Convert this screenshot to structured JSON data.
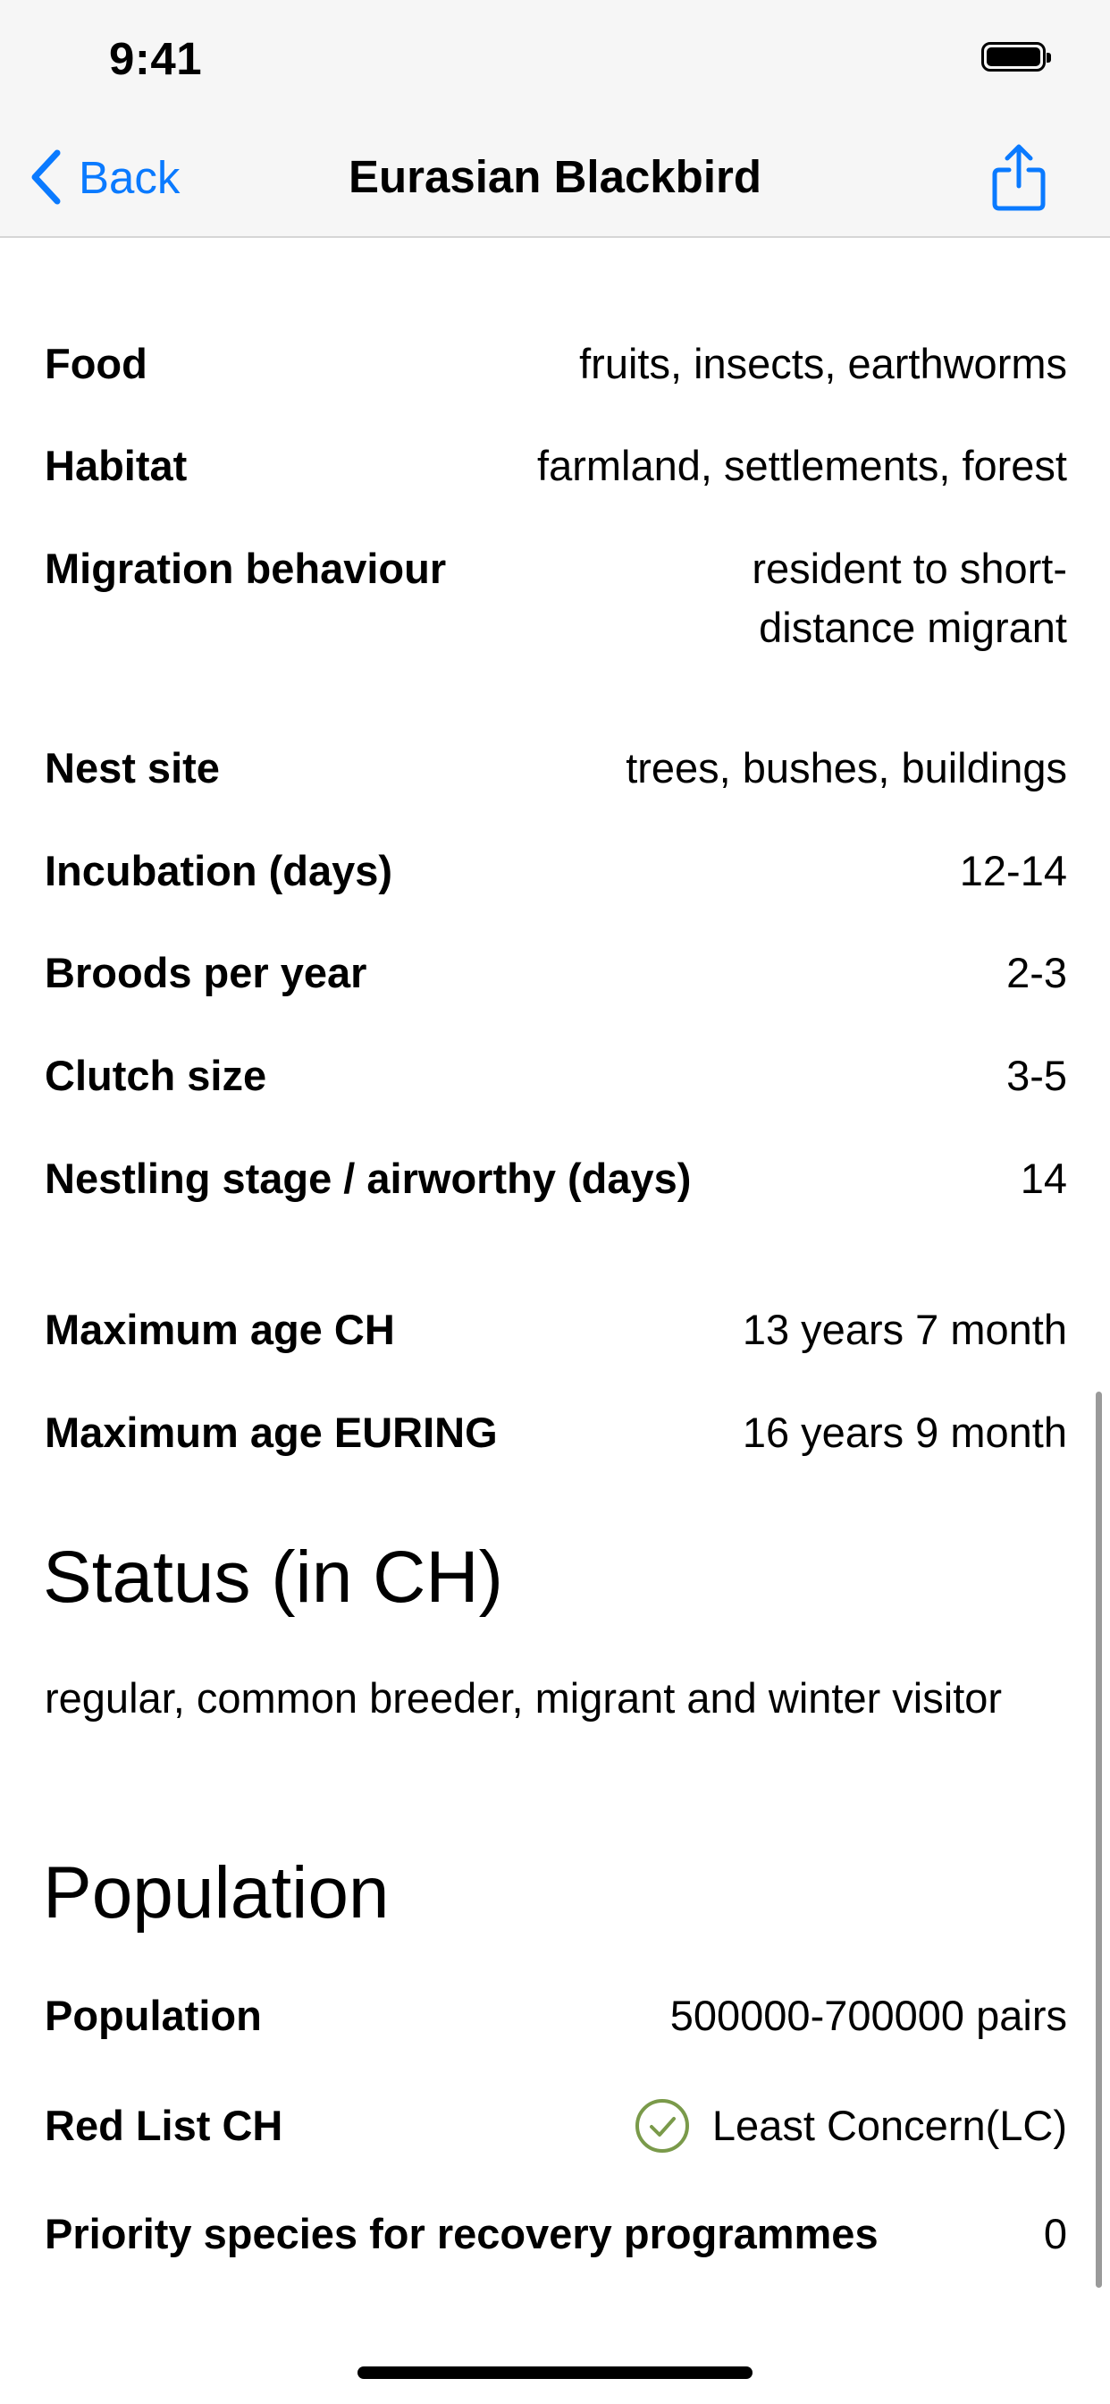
{
  "status_bar": {
    "time": "9:41",
    "battery_icon": "battery-full-icon"
  },
  "nav": {
    "back_label": "Back",
    "title": "Eurasian Blackbird",
    "share_icon": "share-icon",
    "accent_color": "#0a7aff"
  },
  "details": {
    "food": {
      "label": "Food",
      "value": "fruits, insects, earthworms"
    },
    "habitat": {
      "label": "Habitat",
      "value": "farmland, settlements, forest"
    },
    "migration": {
      "label": "Migration behaviour",
      "value": "resident to short-distance migrant"
    },
    "nest_site": {
      "label": "Nest site",
      "value": "trees, bushes, buildings"
    },
    "incubation": {
      "label": "Incubation (days)",
      "value": "12-14"
    },
    "broods": {
      "label": "Broods per year",
      "value": "2-3"
    },
    "clutch": {
      "label": "Clutch size",
      "value": "3-5"
    },
    "nestling": {
      "label": "Nestling stage / airworthy (days)",
      "value": "14"
    },
    "max_age_ch": {
      "label": "Maximum age CH",
      "value": "13 years 7 month"
    },
    "max_age_euring": {
      "label": "Maximum age EURING",
      "value": "16 years 9 month"
    }
  },
  "status_section": {
    "title": "Status (in CH)",
    "text": "regular, common breeder, migrant and winter visitor"
  },
  "population_section": {
    "title": "Population",
    "population": {
      "label": "Population",
      "value": "500000-700000 pairs"
    },
    "red_list": {
      "label": "Red List CH",
      "value": "Least Concern(LC)",
      "icon": "check-circle-icon",
      "icon_color": "#7a9a4a"
    },
    "priority": {
      "label": "Priority species for recovery programmes",
      "value": "0"
    }
  }
}
